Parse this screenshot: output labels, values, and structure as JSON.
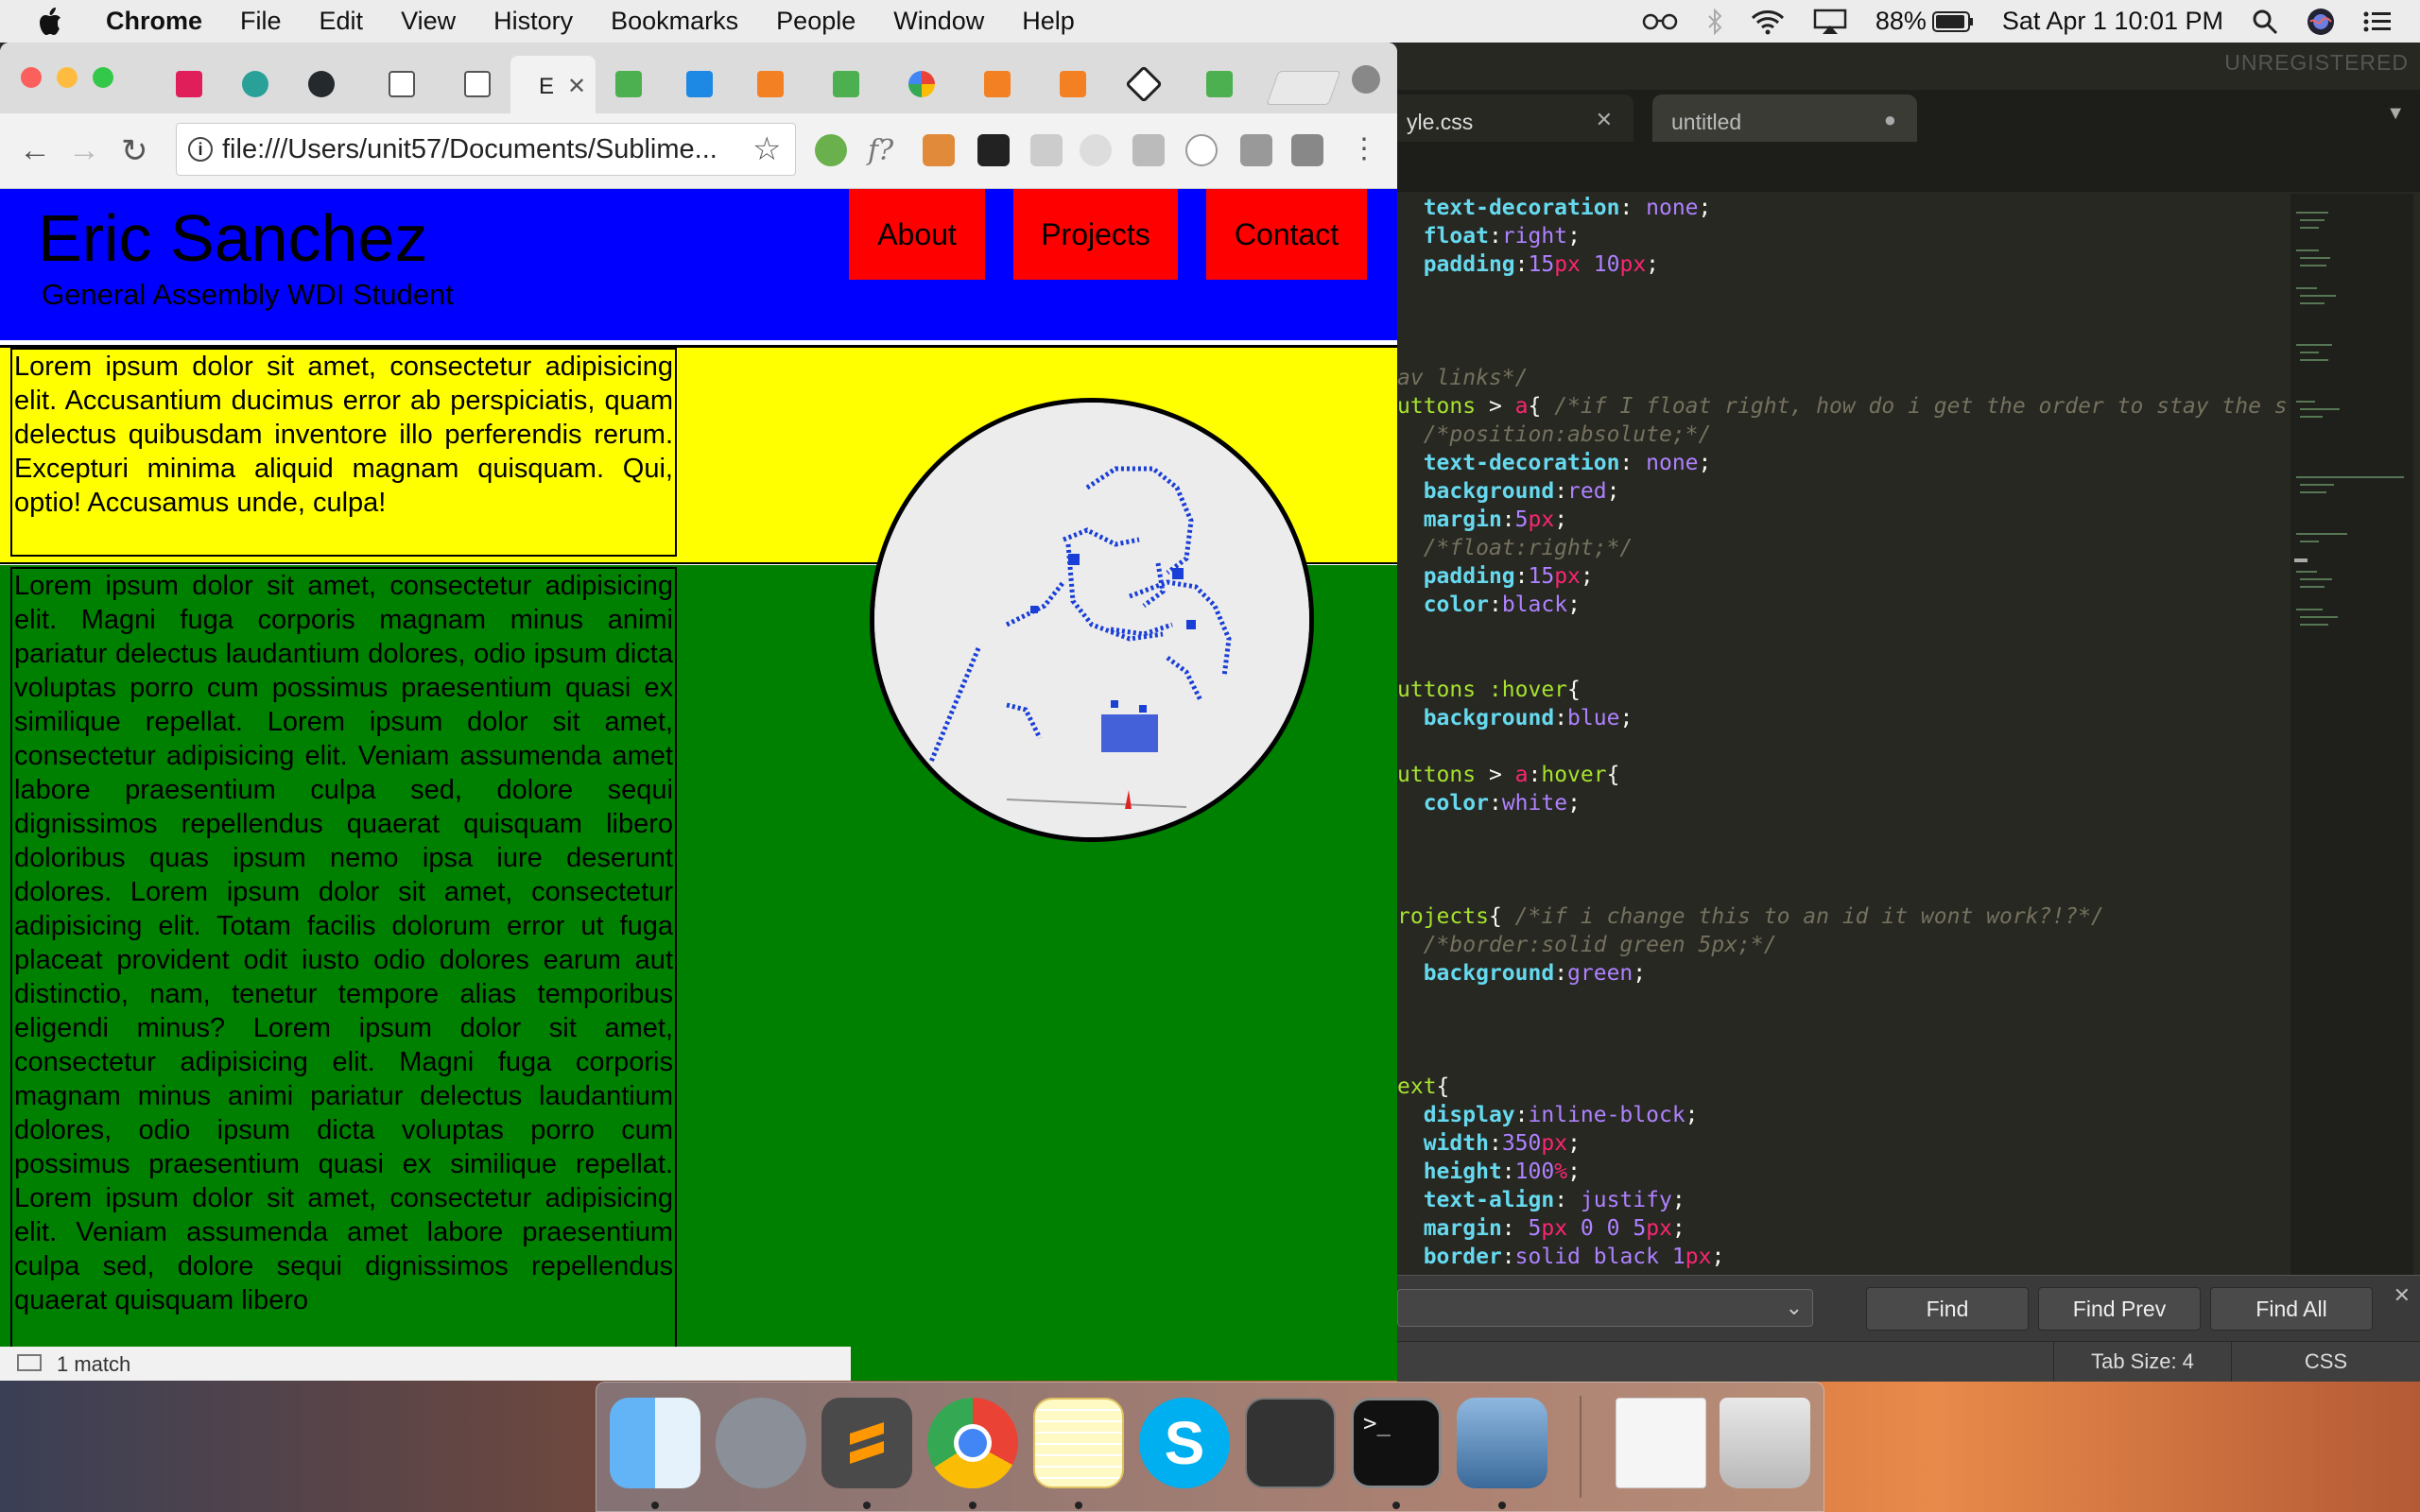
{
  "menubar": {
    "app_name": "Chrome",
    "items": [
      "File",
      "Edit",
      "View",
      "History",
      "Bookmarks",
      "People",
      "Window",
      "Help"
    ],
    "battery": "88%",
    "clock": "Sat Apr 1  10:01 PM"
  },
  "chrome": {
    "active_tab_title": "E",
    "url": "file:///Users/unit57/Documents/Sublime...",
    "status": "1 match"
  },
  "site": {
    "name": "Eric Sanchez",
    "tagline": "General Assembly WDI Student",
    "nav": [
      "About",
      "Projects",
      "Contact"
    ],
    "text1": "Lorem ipsum dolor sit amet, consectetur adipisicing elit. Accusantium ducimus error ab perspiciatis, quam delectus quibusdam inventore illo perferendis rerum. Excepturi minima aliquid magnam quisquam. Qui, optio! Accusamus unde, culpa!",
    "text2": "Lorem ipsum dolor sit amet, consectetur adipisicing elit. Magni fuga corporis magnam minus animi pariatur delectus laudantium dolores, odio ipsum dicta voluptas porro cum possimus praesentium quasi ex similique repellat. Lorem ipsum dolor sit amet, consectetur adipisicing elit. Veniam assumenda amet labore praesentium culpa sed, dolore sequi dignissimos repellendus quaerat quisquam libero doloribus quas ipsum nemo ipsa iure deserunt dolores. Lorem ipsum dolor sit amet, consectetur adipisicing elit. Totam facilis dolorum error ut fuga placeat provident odit iusto odio dolores earum aut distinctio, nam, tenetur tempore alias temporibus eligendi minus? Lorem ipsum dolor sit amet, consectetur adipisicing elit. Magni fuga corporis magnam minus animi pariatur delectus laudantium dolores, odio ipsum dicta voluptas porro cum possimus praesentium quasi ex similique repellat. Lorem ipsum dolor sit amet, consectetur adipisicing elit. Veniam assumenda amet labore praesentium culpa sed, dolore sequi dignissimos repellendus quaerat quisquam libero",
    "colors": {
      "header": "#0000ff",
      "nav": "#ff0000",
      "text_section": "#ffff00",
      "projects": "#008000"
    }
  },
  "sublime": {
    "unregistered": "UNREGISTERED",
    "tabs": [
      "yle.css",
      "untitled"
    ],
    "find_buttons": [
      "Find",
      "Find Prev",
      "Find All"
    ],
    "tab_size": "Tab Size: 4",
    "syntax": "CSS"
  },
  "dock": {
    "icons": [
      "finder-icon",
      "launchpad-icon",
      "sublime-text-icon",
      "chrome-icon",
      "notes-icon",
      "skype-icon",
      "disk-utility-icon",
      "terminal-icon",
      "preview-icon",
      "document-icon",
      "trash-icon"
    ]
  }
}
